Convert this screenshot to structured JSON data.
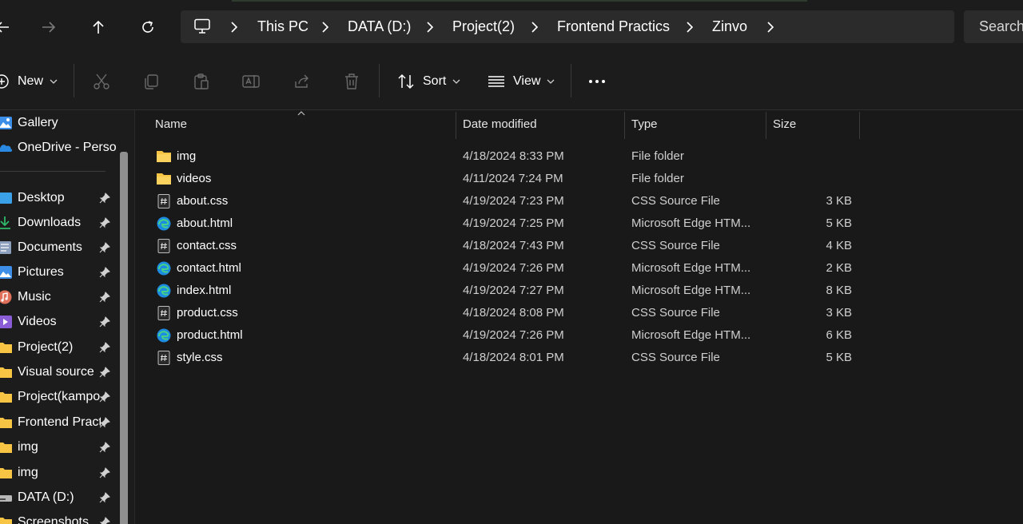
{
  "nav": {
    "back_icon": "arrow-left-icon",
    "forward_icon": "arrow-right-icon",
    "up_icon": "arrow-up-icon",
    "refresh_icon": "refresh-icon"
  },
  "address_bar": {
    "root_icon": "this-pc-icon",
    "crumbs": [
      "This PC",
      "DATA (D:)",
      "Project(2)",
      "Frontend Practics",
      "Zinvo"
    ]
  },
  "search": {
    "placeholder": "Search"
  },
  "toolbar": {
    "new_label": "New",
    "sort_label": "Sort",
    "view_label": "View",
    "actions": [
      "cut-icon",
      "copy-icon",
      "paste-icon",
      "rename-icon",
      "share-icon",
      "delete-icon"
    ],
    "more_icon": "more-options-icon"
  },
  "sidebar": {
    "top_items": [
      {
        "label": "Gallery",
        "icon": "gallery-icon"
      },
      {
        "label": "OneDrive - Personal",
        "icon": "onedrive-icon"
      }
    ],
    "pinned_items": [
      {
        "label": "Desktop",
        "icon": "desktop-icon"
      },
      {
        "label": "Downloads",
        "icon": "downloads-icon"
      },
      {
        "label": "Documents",
        "icon": "documents-icon"
      },
      {
        "label": "Pictures",
        "icon": "pictures-icon"
      },
      {
        "label": "Music",
        "icon": "music-icon"
      },
      {
        "label": "Videos",
        "icon": "videos-icon"
      },
      {
        "label": "Project(2)",
        "icon": "folder-icon"
      },
      {
        "label": "Visual source",
        "icon": "folder-icon"
      },
      {
        "label": "Project(kampong)",
        "icon": "folder-icon"
      },
      {
        "label": "Frontend Practics",
        "icon": "folder-icon"
      },
      {
        "label": "img",
        "icon": "folder-icon"
      },
      {
        "label": "img",
        "icon": "folder-icon"
      },
      {
        "label": "DATA (D:)",
        "icon": "drive-icon"
      },
      {
        "label": "Screenshots",
        "icon": "folder-icon"
      }
    ]
  },
  "columns": {
    "name": "Name",
    "date": "Date modified",
    "type": "Type",
    "size": "Size"
  },
  "files": [
    {
      "name": "img",
      "date": "4/18/2024 8:33 PM",
      "type": "File folder",
      "size": "",
      "icon": "folder-icon"
    },
    {
      "name": "videos",
      "date": "4/11/2024 7:24 PM",
      "type": "File folder",
      "size": "",
      "icon": "folder-icon"
    },
    {
      "name": "about.css",
      "date": "4/19/2024 7:23 PM",
      "type": "CSS Source File",
      "size": "3 KB",
      "icon": "css-file-icon"
    },
    {
      "name": "about.html",
      "date": "4/19/2024 7:25 PM",
      "type": "Microsoft Edge HTM...",
      "size": "5 KB",
      "icon": "edge-html-icon"
    },
    {
      "name": "contact.css",
      "date": "4/18/2024 7:43 PM",
      "type": "CSS Source File",
      "size": "4 KB",
      "icon": "css-file-icon"
    },
    {
      "name": "contact.html",
      "date": "4/19/2024 7:26 PM",
      "type": "Microsoft Edge HTM...",
      "size": "2 KB",
      "icon": "edge-html-icon"
    },
    {
      "name": "index.html",
      "date": "4/19/2024 7:27 PM",
      "type": "Microsoft Edge HTM...",
      "size": "8 KB",
      "icon": "edge-html-icon"
    },
    {
      "name": "product.css",
      "date": "4/18/2024 8:08 PM",
      "type": "CSS Source File",
      "size": "3 KB",
      "icon": "css-file-icon"
    },
    {
      "name": "product.html",
      "date": "4/19/2024 7:26 PM",
      "type": "Microsoft Edge HTM...",
      "size": "6 KB",
      "icon": "edge-html-icon"
    },
    {
      "name": "style.css",
      "date": "4/18/2024 8:01 PM",
      "type": "CSS Source File",
      "size": "5 KB",
      "icon": "css-file-icon"
    }
  ],
  "colors": {
    "background": "#191919",
    "panel": "#1c1c1c",
    "address_bar": "#2b2b2b",
    "folder": "#f8c443",
    "edge_blue": "#1c8be0",
    "text": "#ffffff",
    "muted_text": "#cfcfcf"
  }
}
